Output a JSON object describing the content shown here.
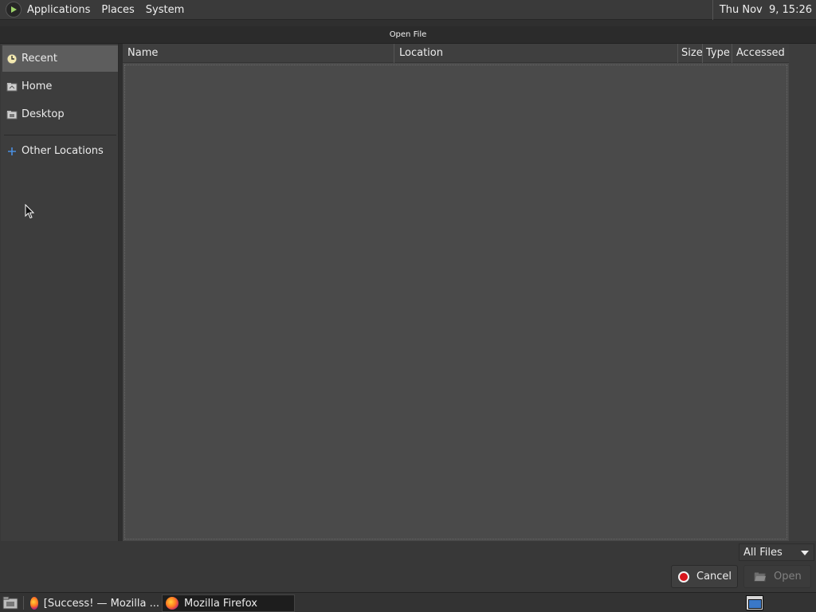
{
  "top_panel": {
    "menu": [
      "Applications",
      "Places",
      "System"
    ],
    "clock": "Thu Nov  9, 15:26"
  },
  "dialog": {
    "title": "Open File"
  },
  "sidebar": {
    "items": [
      {
        "label": "Recent",
        "icon": "recent-icon",
        "active": true
      },
      {
        "label": "Home",
        "icon": "home-folder-icon"
      },
      {
        "label": "Desktop",
        "icon": "desktop-folder-icon"
      },
      {
        "label": "Other Locations",
        "icon": "plus-icon"
      }
    ]
  },
  "file_list": {
    "columns": [
      "Name",
      "Location",
      "Size",
      "Type",
      "Accessed"
    ],
    "rows": []
  },
  "filter": {
    "selected": "All Files"
  },
  "buttons": {
    "cancel": "Cancel",
    "open": "Open"
  },
  "taskbar": {
    "items": [
      {
        "label": "[Success! — Mozilla ...",
        "icon": "firefox-icon",
        "active": false
      },
      {
        "label": "Mozilla Firefox",
        "icon": "firefox-icon",
        "active": true
      }
    ]
  },
  "colors": {
    "cancel_icon": "#d8141b",
    "active_sidebar": "#5d5d5d"
  }
}
